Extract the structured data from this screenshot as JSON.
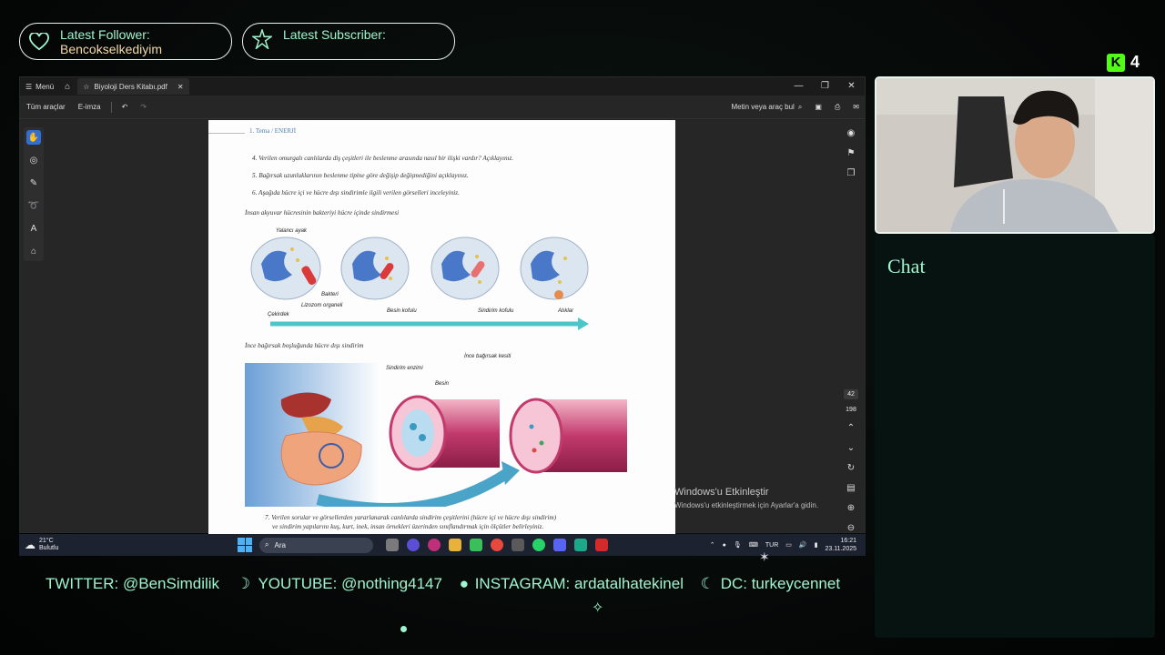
{
  "overlay": {
    "follower": {
      "label": "Latest Follower:",
      "value": "Bencokselkediyim"
    },
    "subscriber": {
      "label": "Latest Subscriber:",
      "value": ""
    },
    "kick_count": "4",
    "chat_title": "Chat",
    "ticker": {
      "twitter": "TWITTER: @BenSimdilik",
      "youtube": "YOUTUBE: @nothing4147",
      "instagram": "INSTAGRAM: ardatalhatekinel",
      "discord": "DC: turkeycennet"
    }
  },
  "browser": {
    "menu_label": "Menü",
    "tab_title": "Biyoloji Ders Kitabı.pdf",
    "toolbar": {
      "all_tools": "Tüm araçlar",
      "esign": "E-imza",
      "search": "Metin veya araç bul"
    },
    "page_current": "42",
    "page_total": "198"
  },
  "pdf": {
    "header": "1. Tema / ENERJİ",
    "questions": [
      "4.  Verilen omurgalı canlılarda diş çeşitleri ile beslenme arasında nasıl bir ilişki vardır? Açıklayınız.",
      "5.  Bağırsak uzunluklarının beslenme tipine göre değişip değişmediğini açıklayınız.",
      "6.  Aşağıda hücre içi ve hücre dışı sindirimle ilgili verilen görselleri inceleyiniz."
    ],
    "caption1": "İnsan akyuvar hücresinin bakteriyi hücre içinde sindirmesi",
    "labels1": {
      "yalanci_ayak": "Yalancı ayak",
      "bakteri": "Bakteri",
      "lizozom": "Lizozom organeli",
      "cekirdek": "Çekirdek",
      "besin_koful": "Besin kofulu",
      "sindirim_koful": "Sindirim kofulu",
      "atiklar": "Atıklar"
    },
    "caption2": "İnce bağırsak boşluğunda hücre dışı sindirim",
    "labels2": {
      "kesit": "İnce bağırsak kesiti",
      "enzim": "Sindirim enzimi",
      "besin": "Besin"
    },
    "question7_line1": "7.  Verilen sorular ve görsellerden yararlanarak canlılarda sindirim çeşitlerini (hücre içi ve hücre dışı sindirim)",
    "question7_line2": "ve sindirim yapılarını kuş, kurt, inek, insan örnekleri üzerinden sınıflandırmak için ölçütler belirleyiniz."
  },
  "windows": {
    "activate_title": "Windows'u Etkinleştir",
    "activate_sub": "Windows'u etkinleştirmek için Ayarlar'a gidin.",
    "weather_temp": "21°C",
    "weather_desc": "Bulutlu",
    "search_placeholder": "Ara",
    "lang": "TUR",
    "time": "16:21",
    "date": "23.11.2025"
  },
  "colors": {
    "accent": "#9ef5cf",
    "kick": "#53fc18",
    "pdf_arrow": "#4cc6c9"
  }
}
